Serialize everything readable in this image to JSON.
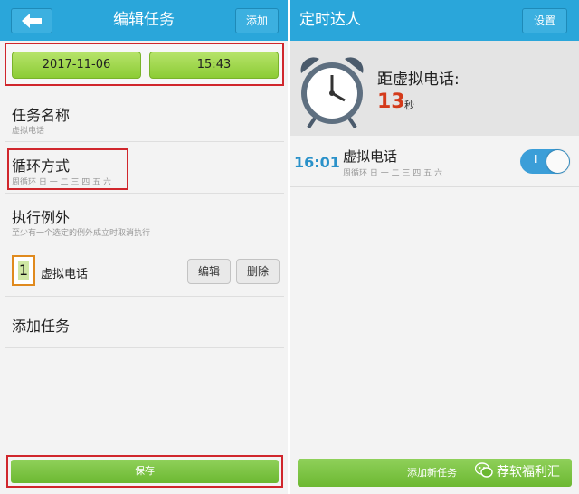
{
  "left_panel": {
    "header": {
      "title": "编辑任务",
      "add_label": "添加",
      "back_icon": "back-arrow-icon"
    },
    "date_value": "2017-11-06",
    "time_value": "15:43",
    "task_name": {
      "title": "任务名称",
      "value": "虚拟电话"
    },
    "repeat": {
      "title": "循环方式",
      "value": "周循环 日 一 二 三 四 五 六"
    },
    "exceptions": {
      "title": "执行例外",
      "hint": "至少有一个选定的例外成立时取消执行",
      "items": [
        {
          "index": "1",
          "name": "虚拟电话",
          "edit_label": "编辑",
          "delete_label": "删除"
        }
      ]
    },
    "add_task_label": "添加任务",
    "save_label": "保存"
  },
  "right_panel": {
    "header": {
      "title": "定时达人",
      "settings_label": "设置"
    },
    "countdown": {
      "label": "距虚拟电话:",
      "value": "13",
      "unit": "秒",
      "icon": "alarm-clock-icon"
    },
    "tasks": [
      {
        "time": "16:01",
        "name": "虚拟电话",
        "repeat": "周循环 日 一 二 三 四 五 六",
        "toggle_label": "I",
        "enabled": true
      }
    ],
    "add_new_task_label": "添加新任务",
    "watermark": "荐软福利汇"
  },
  "colors": {
    "header_blue": "#2aa6da",
    "accent_green": "#8ccc35",
    "highlight_red": "#d0262c",
    "countdown_red": "#d43a1a",
    "time_blue": "#2a91c9"
  }
}
